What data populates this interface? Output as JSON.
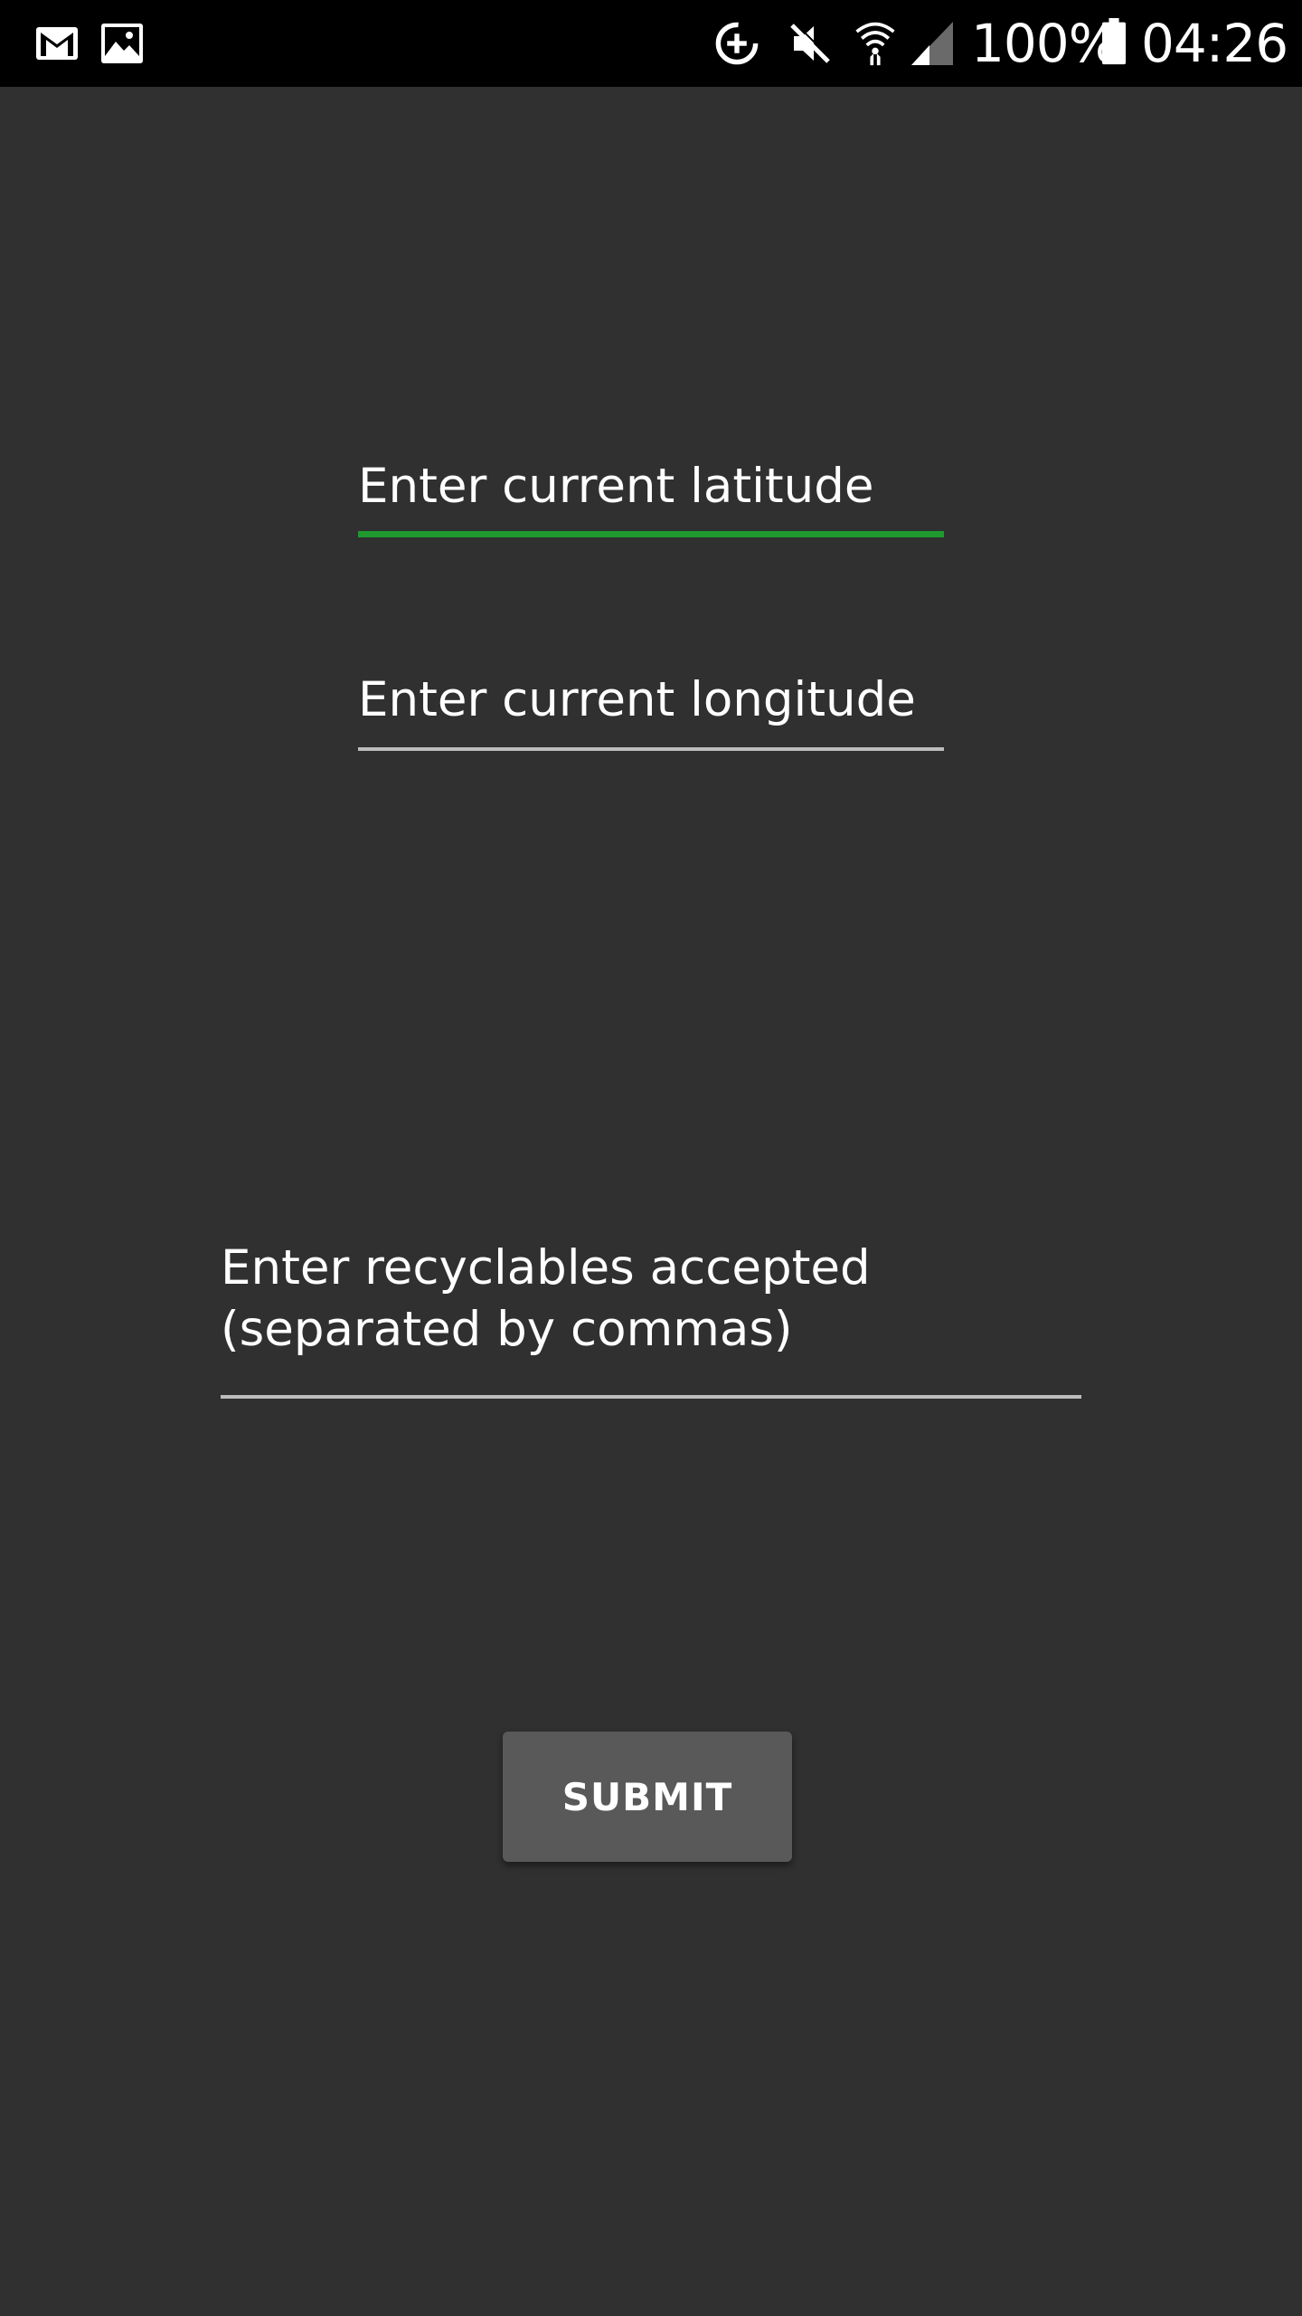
{
  "status_bar": {
    "notification_icons": [
      "gmail-icon",
      "gallery-icon"
    ],
    "system_icons": [
      "data-saver-icon",
      "mute-icon",
      "wifi-icon",
      "cell-signal-icon",
      "battery-icon"
    ],
    "battery_percent": "100%",
    "time": "04:26"
  },
  "form": {
    "latitude": {
      "placeholder": "Enter current latitude",
      "focused": true
    },
    "longitude": {
      "placeholder": "Enter current longitude"
    },
    "recyclables": {
      "placeholder": "Enter recyclables accepted\n(separated by commas)"
    },
    "submit_label": "SUBMIT"
  },
  "colors": {
    "background": "#303030",
    "status_bar": "#000000",
    "focus_accent": "#1e9a2f",
    "underline": "#bdbdbd",
    "button": "#595959"
  }
}
